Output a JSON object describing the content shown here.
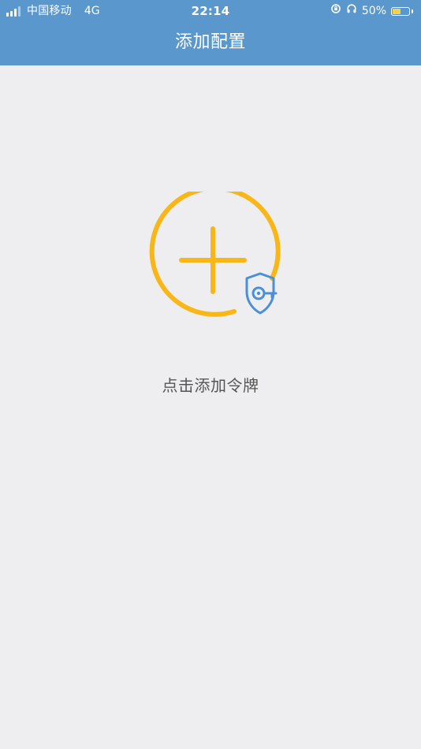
{
  "status_bar": {
    "carrier": "中国移动",
    "network": "4G",
    "time": "22:14",
    "battery_text": "50%",
    "battery_level": 0.5,
    "icons": {
      "signal": "signal-bars-icon",
      "rotation_lock": "rotation-lock-icon",
      "headphones": "headphones-icon",
      "battery": "battery-charging-icon"
    }
  },
  "nav": {
    "title": "添加配置"
  },
  "main": {
    "add_token_label": "点击添加令牌",
    "icons": {
      "add": "add-circle-icon",
      "shield": "shield-key-icon"
    }
  },
  "colors": {
    "header": "#5A97CC",
    "background": "#EEEEF0",
    "accent_yellow": "#F8B717",
    "shield_blue": "#4A90D9",
    "label_text": "#555555"
  }
}
